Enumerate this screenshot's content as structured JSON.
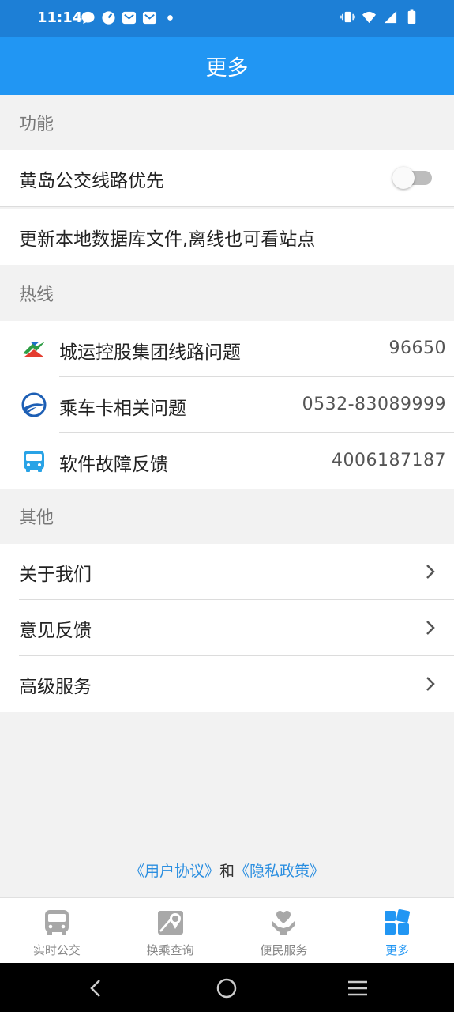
{
  "status_bar": {
    "time": "11:14"
  },
  "title": "更多",
  "sections": {
    "features": {
      "header": "功能",
      "items": [
        {
          "label": "黄岛公交线路优先",
          "toggle_on": false
        },
        {
          "label": "更新本地数据库文件,离线也可看站点"
        }
      ]
    },
    "hotline": {
      "header": "热线",
      "items": [
        {
          "label": "城运控股集团线路问题",
          "number": "96650",
          "icon": "city-transport-logo-icon"
        },
        {
          "label": "乘车卡相关问题",
          "number": "0532-83089999",
          "icon": "transit-card-logo-icon"
        },
        {
          "label": "软件故障反馈",
          "number": "4006187187",
          "icon": "bus-icon"
        }
      ]
    },
    "other": {
      "header": "其他",
      "items": [
        {
          "label": "关于我们"
        },
        {
          "label": "意见反馈"
        },
        {
          "label": "高级服务"
        }
      ]
    }
  },
  "footer": {
    "user_agreement": "《用户协议》",
    "and": "和",
    "privacy_policy": "《隐私政策》"
  },
  "bottom_nav": {
    "items": [
      {
        "label": "实时公交",
        "icon": "bus-icon"
      },
      {
        "label": "换乘查询",
        "icon": "map-pin-icon"
      },
      {
        "label": "便民服务",
        "icon": "hand-heart-icon"
      },
      {
        "label": "更多",
        "icon": "grid-icon",
        "active": true
      }
    ]
  },
  "colors": {
    "primary": "#2196f3",
    "status_bar": "#1d7fd6",
    "link": "#2a8ee0",
    "background": "#f2f2f2"
  }
}
